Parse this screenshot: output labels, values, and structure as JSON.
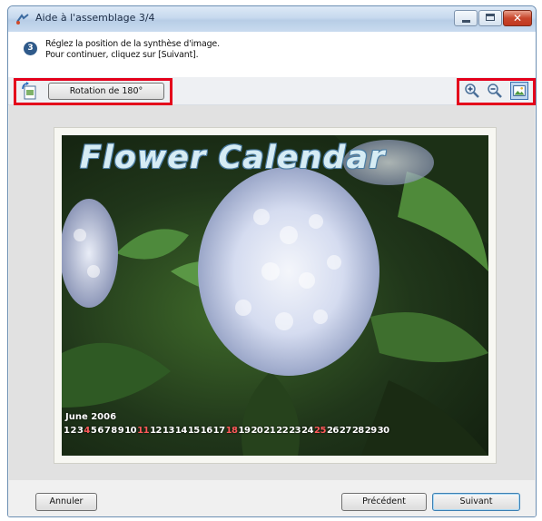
{
  "window": {
    "title": "Aide à l'assemblage 3/4",
    "controls": {
      "close": "✕"
    }
  },
  "header": {
    "step_number": "3",
    "instruction_line1": "Réglez la position de la synthèse d'image.",
    "instruction_line2": "Pour continuer, cliquez sur [Suivant]."
  },
  "toolbar": {
    "rotate_label": "Rotation de 180°",
    "icons": [
      "rotate-page-icon",
      "zoom-in-icon",
      "zoom-out-icon",
      "fit-to-window-icon"
    ]
  },
  "preview": {
    "title": "Flower Calendar",
    "month": "June 2006",
    "days": [
      "1",
      "2",
      "3",
      "4",
      "5",
      "6",
      "7",
      "8",
      "9",
      "10",
      "11",
      "12",
      "13",
      "14",
      "15",
      "16",
      "17",
      "18",
      "19",
      "20",
      "21",
      "22",
      "23",
      "24",
      "25",
      "26",
      "27",
      "28",
      "29",
      "30"
    ],
    "red_days": [
      "4",
      "11",
      "18",
      "25"
    ]
  },
  "footer": {
    "cancel_label": "Annuler",
    "prev_label": "Précédent",
    "next_label": "Suivant"
  },
  "colors": {
    "highlight_box": "#e4001b",
    "title_bar": "#c6d9ee",
    "calendar_title": "#d6ecf4",
    "sunday_red": "#ff5b5b"
  }
}
